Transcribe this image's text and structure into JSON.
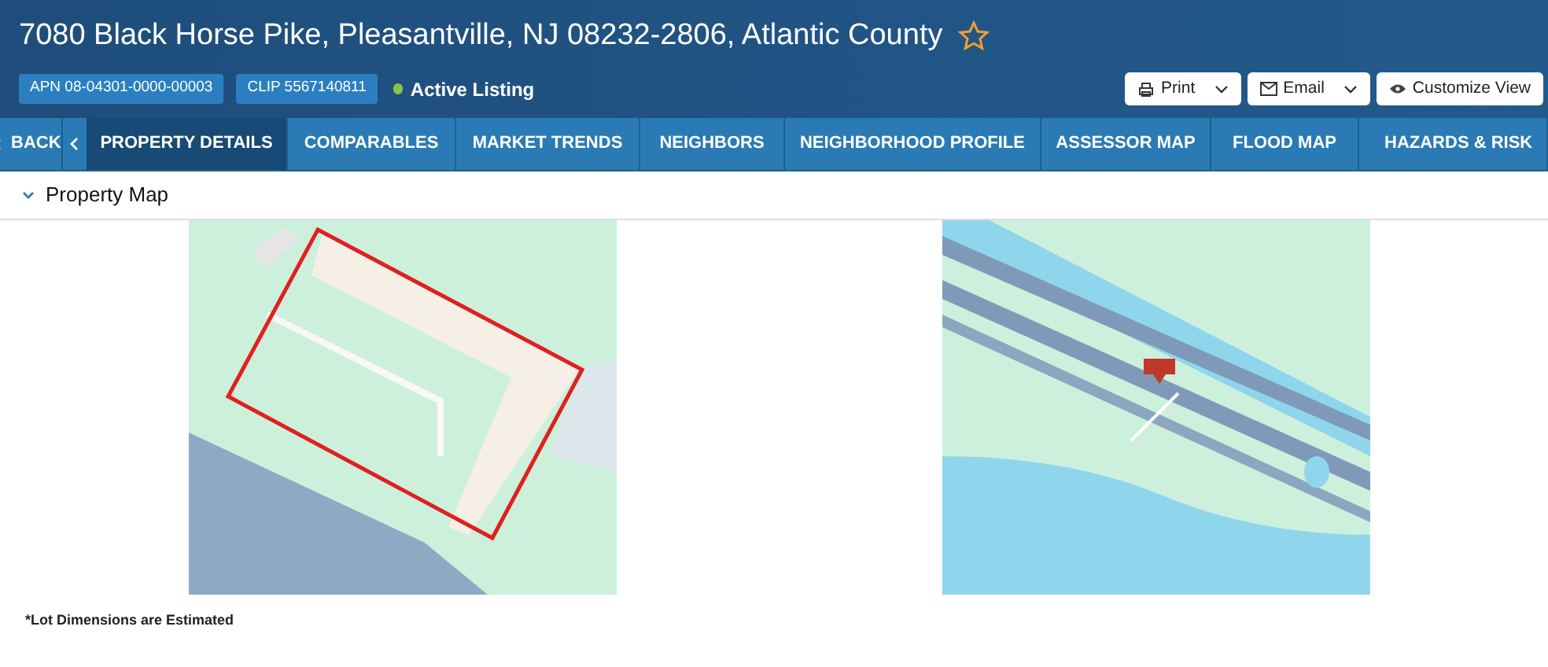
{
  "header": {
    "title": "7080 Black Horse Pike, Pleasantville, NJ 08232-2806, Atlantic County",
    "favorite": false,
    "badges": [
      "APN 08-04301-0000-00003",
      "CLIP 5567140811"
    ],
    "status": {
      "label": "Active Listing",
      "color": "#8bc34a"
    },
    "actions": [
      {
        "label": "Print",
        "kind": "print",
        "dropdown": true
      },
      {
        "label": "Email",
        "kind": "mail",
        "dropdown": true
      },
      {
        "label": "Customize View",
        "kind": "eye",
        "dropdown": false
      }
    ]
  },
  "nav": {
    "back": "BACK",
    "tabs": [
      {
        "label": "PROPERTY DETAILS",
        "selected": true
      },
      {
        "label": "COMPARABLES",
        "selected": false
      },
      {
        "label": "MARKET TRENDS",
        "selected": false
      },
      {
        "label": "NEIGHBORS",
        "selected": false
      },
      {
        "label": "NEIGHBORHOOD PROFILE",
        "selected": false
      },
      {
        "label": "ASSESSOR MAP",
        "selected": false
      },
      {
        "label": "FLOOD MAP",
        "selected": false
      },
      {
        "label": "HAZARDS & RISK",
        "selected": false
      }
    ]
  },
  "section": {
    "title": "Property Map",
    "expanded": true,
    "footnote": "*Lot Dimensions are Estimated"
  }
}
